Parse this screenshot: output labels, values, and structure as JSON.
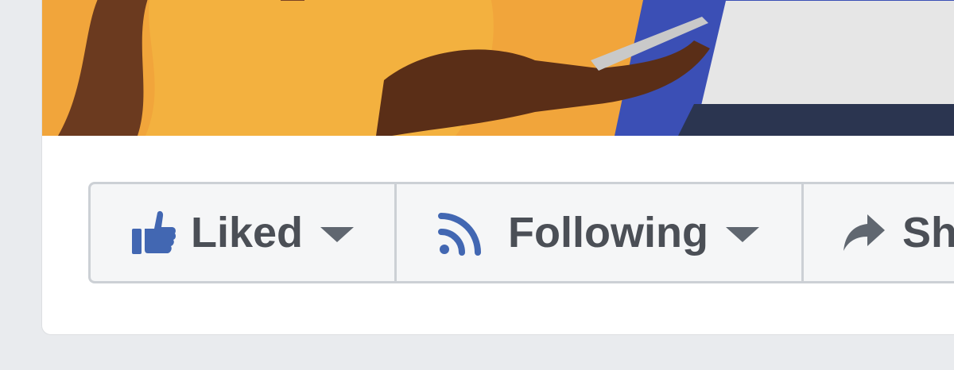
{
  "page_actions": {
    "liked": {
      "label": "Liked",
      "icon": "thumbs-up-icon",
      "dropdown_icon": "caret-down-icon"
    },
    "following": {
      "label": "Following",
      "icon": "rss-feed-icon",
      "dropdown_icon": "caret-down-icon"
    },
    "share": {
      "label": "Sh",
      "icon": "share-arrow-icon"
    }
  },
  "colors": {
    "accent": "#4267b2",
    "text": "#4b4f56",
    "button_bg": "#f5f6f7",
    "border": "#ccd0d5",
    "page_bg": "#e9ebee",
    "cover_orange": "#f1a53b",
    "cover_blue": "#3b4fb5"
  }
}
